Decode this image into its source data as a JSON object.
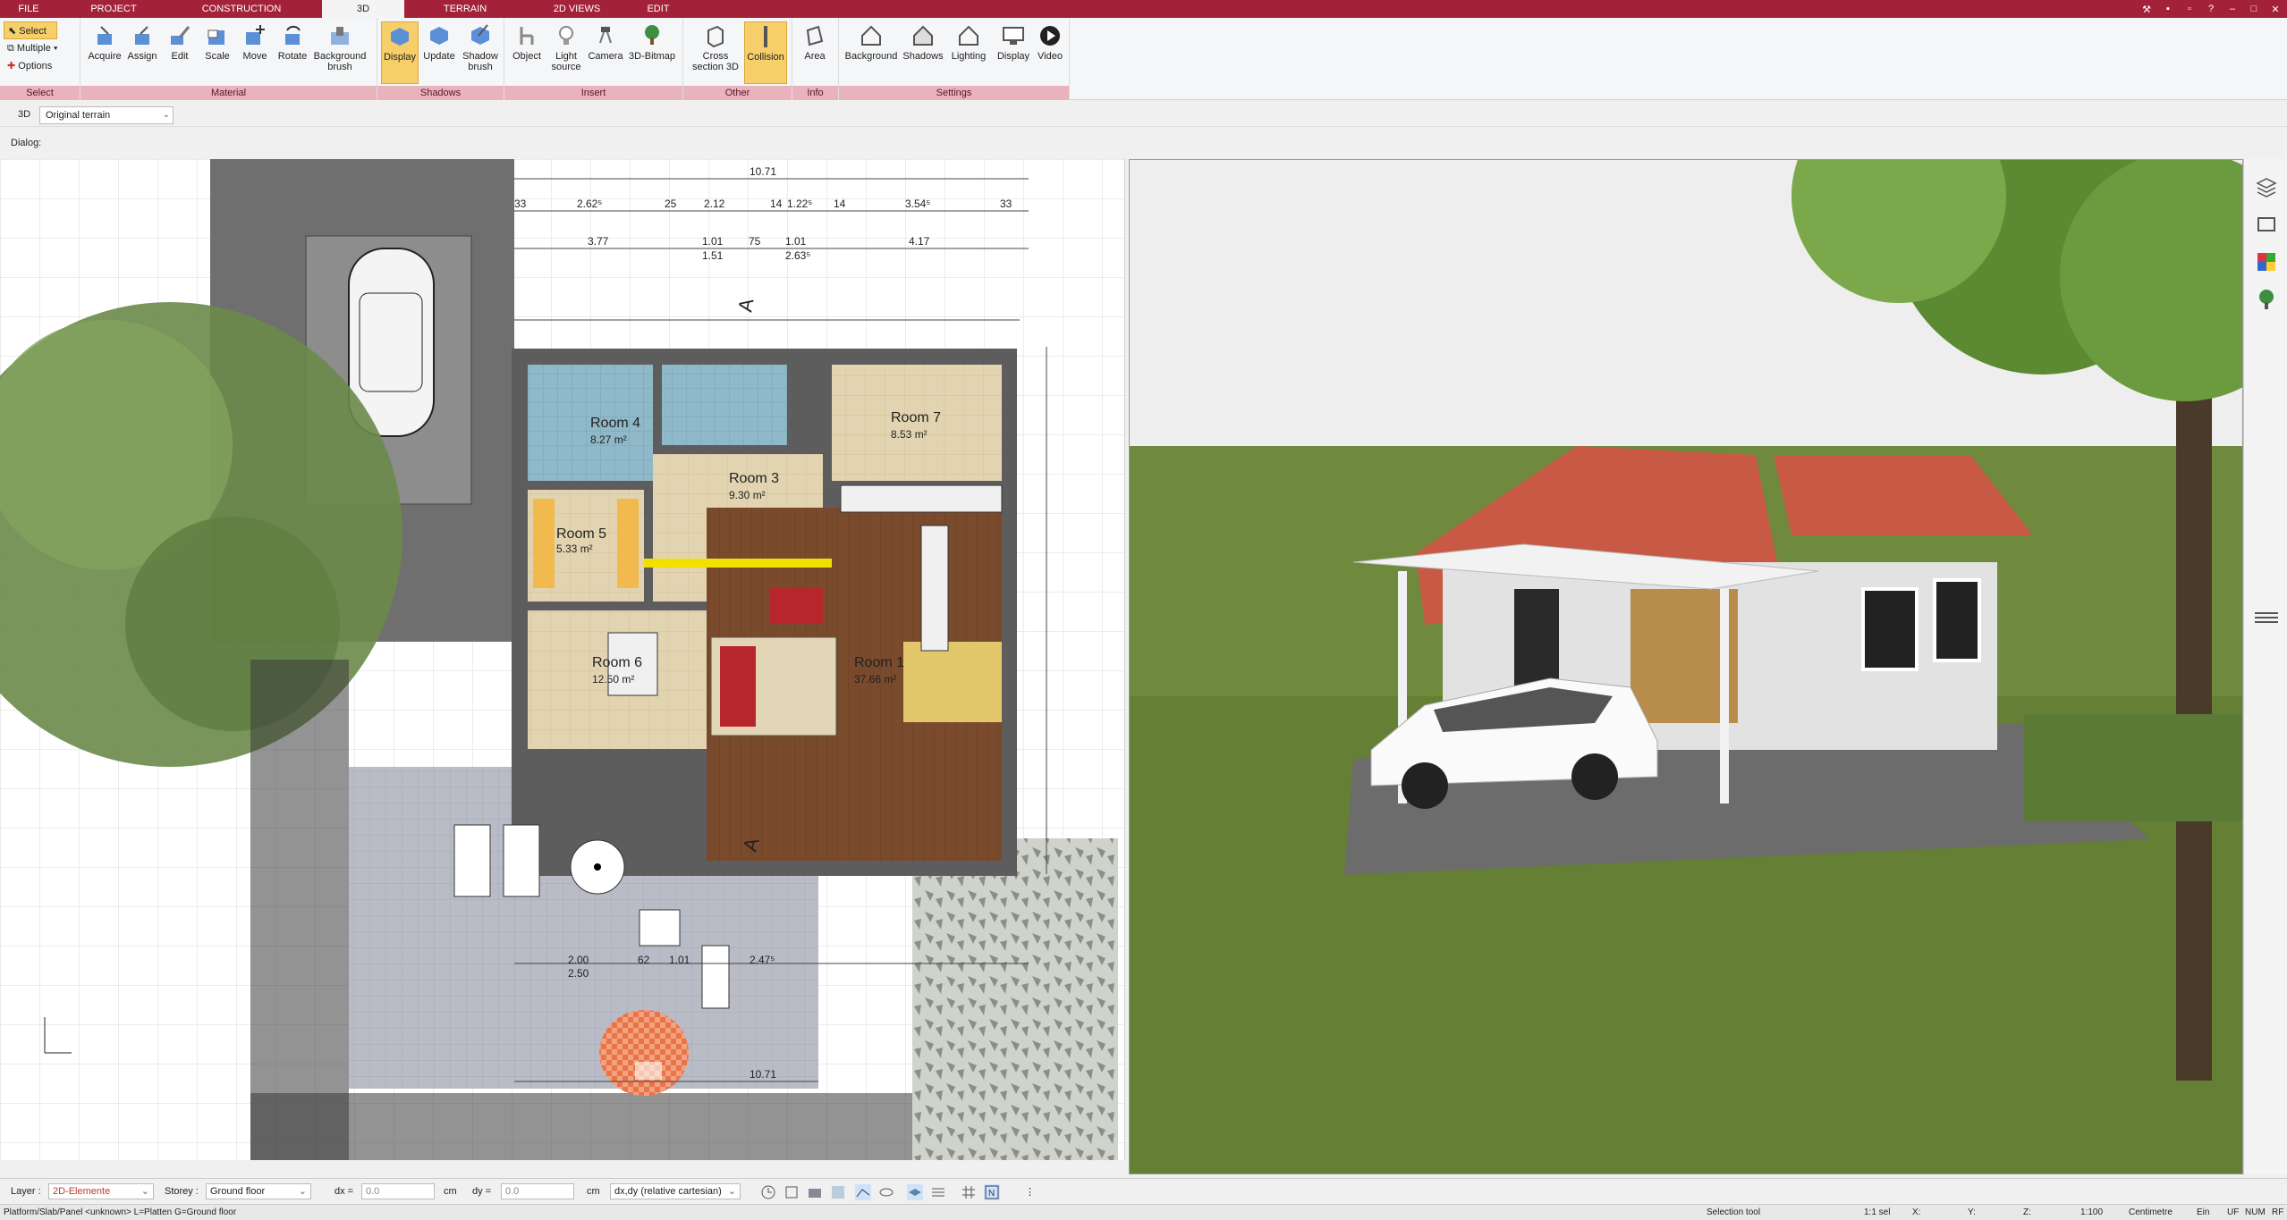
{
  "menubar": {
    "tabs": [
      "FILE",
      "PROJECT",
      "CONSTRUCTION",
      "3D",
      "TERRAIN",
      "2D VIEWS",
      "EDIT"
    ],
    "active_tab": "3D"
  },
  "ribbon": {
    "select": {
      "select_label": "Select",
      "multiple_label": "Multiple",
      "options_label": "Options",
      "group_label": "Select"
    },
    "material": {
      "buttons": [
        "Acquire",
        "Assign",
        "Edit",
        "Scale",
        "Move",
        "Rotate",
        "Background brush"
      ],
      "group_label": "Material"
    },
    "shadows": {
      "buttons": [
        "Display",
        "Update",
        "Shadow brush"
      ],
      "group_label": "Shadows"
    },
    "insert": {
      "buttons": [
        "Object",
        "Light source",
        "Camera",
        "3D-Bitmap"
      ],
      "group_label": "Insert"
    },
    "other": {
      "buttons": [
        "Cross section 3D",
        "Collision"
      ],
      "group_label": "Other"
    },
    "info": {
      "buttons": [
        "Area"
      ],
      "group_label": "Info"
    },
    "settings": {
      "buttons": [
        "Background",
        "Shadows",
        "Lighting",
        "Display",
        "Video"
      ],
      "group_label": "Settings"
    }
  },
  "toolbar3d": {
    "label": "3D",
    "terrain_value": "Original terrain"
  },
  "dialog": {
    "label": "Dialog:"
  },
  "plan": {
    "dims_top": [
      "10.71",
      "33",
      "2.62⁵",
      "25",
      "2.12",
      "14",
      "1.22⁵",
      "14",
      "3.54⁵",
      "33",
      "3.77",
      "1.01",
      "75",
      "1.01",
      "4.17",
      "1.51",
      "2.63⁵"
    ],
    "rooms": [
      {
        "name": "Room 4",
        "area": "8.27 m²"
      },
      {
        "name": "Room 7",
        "area": "8.53 m²"
      },
      {
        "name": "Room 5",
        "area": "5.33 m²"
      },
      {
        "name": "Room 3",
        "area": "9.30 m²"
      },
      {
        "name": "Room 6",
        "area": "12.50 m²"
      },
      {
        "name": "Room 1",
        "area": "37.66 m²"
      }
    ],
    "dims_bottom": [
      "10.71",
      "2.00",
      "2.50",
      "62",
      "1.01",
      "2.47⁵"
    ],
    "section_marker": "A"
  },
  "layerbar": {
    "layer_label": "Layer :",
    "layer_value": "2D-Elemente",
    "storey_label": "Storey :",
    "storey_value": "Ground floor",
    "dx_label": "dx =",
    "dx_value": "0.0",
    "dy_label": "dy =",
    "dy_value": "0.0",
    "unit": "cm",
    "coord_mode": "dx,dy (relative cartesian)"
  },
  "status": {
    "left": "Platform/Slab/Panel <unknown> L=Platten G=Ground floor",
    "tool": "Selection tool",
    "sel": "1:1 sel",
    "x": "X:",
    "y": "Y:",
    "z": "Z:",
    "scale": "1:100",
    "units": "Centimetre",
    "ein": "Ein",
    "uf": "UF",
    "num": "NUM",
    "rf": "RF"
  },
  "colors": {
    "brand": "#a3223a",
    "ribbon_group": "#e9b3bd",
    "active_button": "#f6cf6a",
    "grass": "#6f8a3c",
    "sky": "#eeeeee",
    "roof": "#c85a45"
  }
}
